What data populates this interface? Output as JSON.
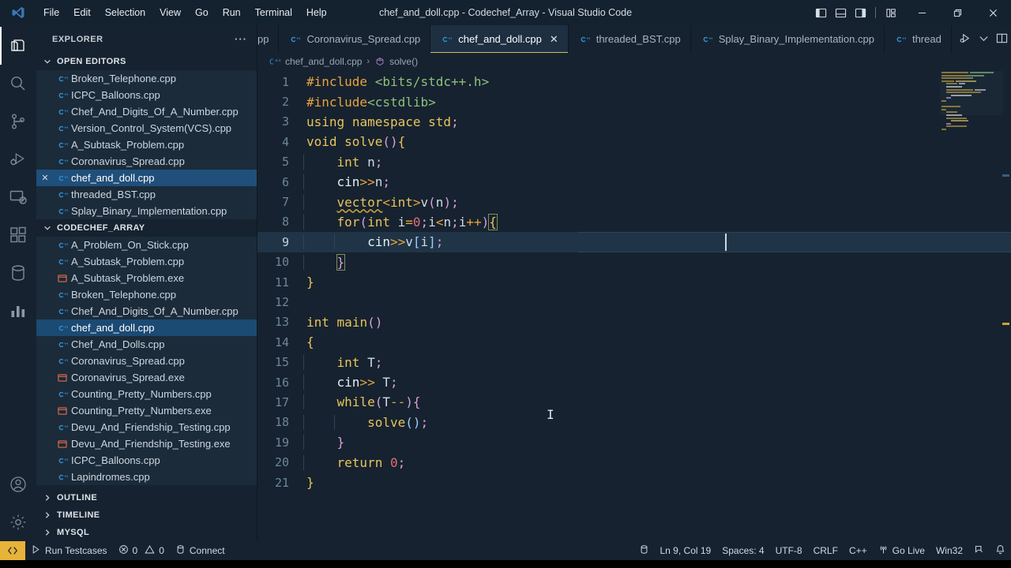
{
  "window": {
    "title": "chef_and_doll.cpp - Codechef_Array - Visual Studio Code",
    "menu": [
      "File",
      "Edit",
      "Selection",
      "View",
      "Go",
      "Run",
      "Terminal",
      "Help"
    ],
    "layout_controls": [
      "toggle-primary-sidebar",
      "toggle-panel",
      "toggle-secondary-sidebar",
      "customize-layout"
    ],
    "controls": [
      "minimize",
      "restore",
      "close"
    ]
  },
  "activitybar": {
    "items": [
      {
        "name": "explorer",
        "icon": "files-icon",
        "active": true
      },
      {
        "name": "search",
        "icon": "search-icon",
        "active": false
      },
      {
        "name": "source-control",
        "icon": "source-control-icon",
        "active": false
      },
      {
        "name": "run-and-debug",
        "icon": "run-debug-icon",
        "active": false
      },
      {
        "name": "remote-explorer",
        "icon": "remote-explorer-icon",
        "active": false
      },
      {
        "name": "extensions",
        "icon": "extensions-icon",
        "active": false
      },
      {
        "name": "database",
        "icon": "database-icon",
        "active": false
      },
      {
        "name": "chart",
        "icon": "chart-icon",
        "active": false
      }
    ],
    "bottom": [
      {
        "name": "accounts",
        "icon": "account-icon"
      },
      {
        "name": "manage",
        "icon": "gear-icon"
      }
    ]
  },
  "sidebar": {
    "header": "EXPLORER",
    "more_actions": "···",
    "open_editors": {
      "label": "OPEN EDITORS",
      "expanded": true,
      "items": [
        {
          "label": "Broken_Telephone.cpp",
          "icon": "cpp-icon",
          "active": false
        },
        {
          "label": "ICPC_Balloons.cpp",
          "icon": "cpp-icon",
          "active": false
        },
        {
          "label": "Chef_And_Digits_Of_A_Number.cpp",
          "icon": "cpp-icon",
          "active": false
        },
        {
          "label": "Version_Control_System(VCS).cpp",
          "icon": "cpp-icon",
          "active": false
        },
        {
          "label": "A_Subtask_Problem.cpp",
          "icon": "cpp-icon",
          "active": false
        },
        {
          "label": "Coronavirus_Spread.cpp",
          "icon": "cpp-icon",
          "active": false
        },
        {
          "label": "chef_and_doll.cpp",
          "icon": "cpp-icon",
          "active": true
        },
        {
          "label": "threaded_BST.cpp",
          "icon": "cpp-icon",
          "active": false
        },
        {
          "label": "Splay_Binary_Implementation.cpp",
          "icon": "cpp-icon",
          "active": false
        }
      ]
    },
    "folder": {
      "label": "CODECHEF_ARRAY",
      "expanded": true,
      "items": [
        {
          "label": "A_Problem_On_Stick.cpp",
          "icon": "cpp-icon",
          "active": false
        },
        {
          "label": "A_Subtask_Problem.cpp",
          "icon": "cpp-icon",
          "active": false
        },
        {
          "label": "A_Subtask_Problem.exe",
          "icon": "exe-icon",
          "active": false
        },
        {
          "label": "Broken_Telephone.cpp",
          "icon": "cpp-icon",
          "active": false
        },
        {
          "label": "Chef_And_Digits_Of_A_Number.cpp",
          "icon": "cpp-icon",
          "active": false
        },
        {
          "label": "chef_and_doll.cpp",
          "icon": "cpp-icon",
          "active": true
        },
        {
          "label": "Chef_And_Dolls.cpp",
          "icon": "cpp-icon",
          "active": false
        },
        {
          "label": "Coronavirus_Spread.cpp",
          "icon": "cpp-icon",
          "active": false
        },
        {
          "label": "Coronavirus_Spread.exe",
          "icon": "exe-icon",
          "active": false
        },
        {
          "label": "Counting_Pretty_Numbers.cpp",
          "icon": "cpp-icon",
          "active": false
        },
        {
          "label": "Counting_Pretty_Numbers.exe",
          "icon": "exe-icon",
          "active": false
        },
        {
          "label": "Devu_And_Friendship_Testing.cpp",
          "icon": "cpp-icon",
          "active": false
        },
        {
          "label": "Devu_And_Friendship_Testing.exe",
          "icon": "exe-icon",
          "active": false
        },
        {
          "label": "ICPC_Balloons.cpp",
          "icon": "cpp-icon",
          "active": false
        },
        {
          "label": "Lapindromes.cpp",
          "icon": "cpp-icon",
          "active": false
        }
      ]
    },
    "bottom_sections": [
      {
        "label": "OUTLINE",
        "expanded": false
      },
      {
        "label": "TIMELINE",
        "expanded": false
      },
      {
        "label": "MYSQL",
        "expanded": false
      }
    ]
  },
  "tabs": {
    "items": [
      {
        "label": "pp",
        "icon": "cpp-icon",
        "active": false,
        "truncated": true
      },
      {
        "label": "Coronavirus_Spread.cpp",
        "icon": "cpp-icon",
        "active": false
      },
      {
        "label": "chef_and_doll.cpp",
        "icon": "cpp-icon",
        "active": true,
        "close": "✕"
      },
      {
        "label": "threaded_BST.cpp",
        "icon": "cpp-icon",
        "active": false
      },
      {
        "label": "Splay_Binary_Implementation.cpp",
        "icon": "cpp-icon",
        "active": false
      },
      {
        "label": "thread",
        "icon": "cpp-icon",
        "active": false,
        "truncated": true
      }
    ],
    "actions": [
      "run-or-debug-icon",
      "chevron-down-icon",
      "gear-icon",
      "split-editor-icon",
      "more-icon"
    ]
  },
  "breadcrumb": {
    "file": "chef_and_doll.cpp",
    "separator": "›",
    "symbol": "solve()"
  },
  "editor": {
    "language": "C++",
    "current_line": 9,
    "lines": [
      {
        "n": 1,
        "text": "#include <bits/stdc++.h>"
      },
      {
        "n": 2,
        "text": "#include<cstdlib>"
      },
      {
        "n": 3,
        "text": "using namespace std;"
      },
      {
        "n": 4,
        "text": "void solve(){"
      },
      {
        "n": 5,
        "text": "    int n;"
      },
      {
        "n": 6,
        "text": "    cin>>n;"
      },
      {
        "n": 7,
        "text": "    vector<int>v(n);"
      },
      {
        "n": 8,
        "text": "    for(int i=0;i<n;i++){"
      },
      {
        "n": 9,
        "text": "        cin>>v[i];"
      },
      {
        "n": 10,
        "text": "    }"
      },
      {
        "n": 11,
        "text": "}"
      },
      {
        "n": 12,
        "text": ""
      },
      {
        "n": 13,
        "text": "int main()"
      },
      {
        "n": 14,
        "text": "{"
      },
      {
        "n": 15,
        "text": "    int T;"
      },
      {
        "n": 16,
        "text": "    cin>> T;"
      },
      {
        "n": 17,
        "text": "    while(T--){"
      },
      {
        "n": 18,
        "text": "        solve();"
      },
      {
        "n": 19,
        "text": "    }"
      },
      {
        "n": 20,
        "text": "    return 0;"
      },
      {
        "n": 21,
        "text": "}"
      }
    ]
  },
  "statusbar": {
    "remote_icon": "remote-window-icon",
    "left": [
      {
        "label": "Run Testcases",
        "icon": "play-icon"
      },
      {
        "label": "0",
        "icon": "error-icon",
        "second_label": "0",
        "second_icon": "warning-icon"
      },
      {
        "label": "Connect",
        "icon": "database-icon"
      }
    ],
    "errors": "0",
    "warnings": "0",
    "right": [
      {
        "label": "",
        "icon": "database-icon"
      },
      {
        "label": "Ln 9, Col 19",
        "icon": ""
      },
      {
        "label": "Spaces: 4",
        "icon": ""
      },
      {
        "label": "UTF-8",
        "icon": ""
      },
      {
        "label": "CRLF",
        "icon": ""
      },
      {
        "label": "C++",
        "icon": ""
      },
      {
        "label": "Go Live",
        "icon": "broadcast-icon"
      },
      {
        "label": "Win32",
        "icon": ""
      },
      {
        "label": "",
        "icon": "feedback-icon"
      },
      {
        "label": "",
        "icon": "bell-icon"
      }
    ]
  },
  "colors": {
    "background": "#16222f",
    "sidebar_tree": "#1b2b3a",
    "selection_blue": "#1f4f7a",
    "accent_yellow": "#e8b339",
    "tab_active_underline": "#d4bd6a",
    "cpp_icon": "#2f8ecf",
    "exe_icon": "#e06c4a"
  }
}
